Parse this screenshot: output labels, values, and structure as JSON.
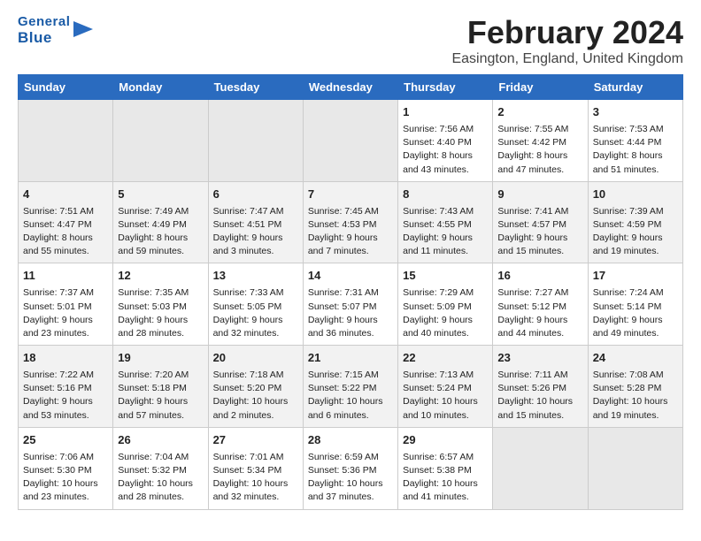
{
  "header": {
    "logo_general": "General",
    "logo_blue": "Blue",
    "title": "February 2024",
    "subtitle": "Easington, England, United Kingdom"
  },
  "weekdays": [
    "Sunday",
    "Monday",
    "Tuesday",
    "Wednesday",
    "Thursday",
    "Friday",
    "Saturday"
  ],
  "weeks": [
    [
      {
        "day": "",
        "info": ""
      },
      {
        "day": "",
        "info": ""
      },
      {
        "day": "",
        "info": ""
      },
      {
        "day": "",
        "info": ""
      },
      {
        "day": "1",
        "info": "Sunrise: 7:56 AM\nSunset: 4:40 PM\nDaylight: 8 hours\nand 43 minutes."
      },
      {
        "day": "2",
        "info": "Sunrise: 7:55 AM\nSunset: 4:42 PM\nDaylight: 8 hours\nand 47 minutes."
      },
      {
        "day": "3",
        "info": "Sunrise: 7:53 AM\nSunset: 4:44 PM\nDaylight: 8 hours\nand 51 minutes."
      }
    ],
    [
      {
        "day": "4",
        "info": "Sunrise: 7:51 AM\nSunset: 4:47 PM\nDaylight: 8 hours\nand 55 minutes."
      },
      {
        "day": "5",
        "info": "Sunrise: 7:49 AM\nSunset: 4:49 PM\nDaylight: 8 hours\nand 59 minutes."
      },
      {
        "day": "6",
        "info": "Sunrise: 7:47 AM\nSunset: 4:51 PM\nDaylight: 9 hours\nand 3 minutes."
      },
      {
        "day": "7",
        "info": "Sunrise: 7:45 AM\nSunset: 4:53 PM\nDaylight: 9 hours\nand 7 minutes."
      },
      {
        "day": "8",
        "info": "Sunrise: 7:43 AM\nSunset: 4:55 PM\nDaylight: 9 hours\nand 11 minutes."
      },
      {
        "day": "9",
        "info": "Sunrise: 7:41 AM\nSunset: 4:57 PM\nDaylight: 9 hours\nand 15 minutes."
      },
      {
        "day": "10",
        "info": "Sunrise: 7:39 AM\nSunset: 4:59 PM\nDaylight: 9 hours\nand 19 minutes."
      }
    ],
    [
      {
        "day": "11",
        "info": "Sunrise: 7:37 AM\nSunset: 5:01 PM\nDaylight: 9 hours\nand 23 minutes."
      },
      {
        "day": "12",
        "info": "Sunrise: 7:35 AM\nSunset: 5:03 PM\nDaylight: 9 hours\nand 28 minutes."
      },
      {
        "day": "13",
        "info": "Sunrise: 7:33 AM\nSunset: 5:05 PM\nDaylight: 9 hours\nand 32 minutes."
      },
      {
        "day": "14",
        "info": "Sunrise: 7:31 AM\nSunset: 5:07 PM\nDaylight: 9 hours\nand 36 minutes."
      },
      {
        "day": "15",
        "info": "Sunrise: 7:29 AM\nSunset: 5:09 PM\nDaylight: 9 hours\nand 40 minutes."
      },
      {
        "day": "16",
        "info": "Sunrise: 7:27 AM\nSunset: 5:12 PM\nDaylight: 9 hours\nand 44 minutes."
      },
      {
        "day": "17",
        "info": "Sunrise: 7:24 AM\nSunset: 5:14 PM\nDaylight: 9 hours\nand 49 minutes."
      }
    ],
    [
      {
        "day": "18",
        "info": "Sunrise: 7:22 AM\nSunset: 5:16 PM\nDaylight: 9 hours\nand 53 minutes."
      },
      {
        "day": "19",
        "info": "Sunrise: 7:20 AM\nSunset: 5:18 PM\nDaylight: 9 hours\nand 57 minutes."
      },
      {
        "day": "20",
        "info": "Sunrise: 7:18 AM\nSunset: 5:20 PM\nDaylight: 10 hours\nand 2 minutes."
      },
      {
        "day": "21",
        "info": "Sunrise: 7:15 AM\nSunset: 5:22 PM\nDaylight: 10 hours\nand 6 minutes."
      },
      {
        "day": "22",
        "info": "Sunrise: 7:13 AM\nSunset: 5:24 PM\nDaylight: 10 hours\nand 10 minutes."
      },
      {
        "day": "23",
        "info": "Sunrise: 7:11 AM\nSunset: 5:26 PM\nDaylight: 10 hours\nand 15 minutes."
      },
      {
        "day": "24",
        "info": "Sunrise: 7:08 AM\nSunset: 5:28 PM\nDaylight: 10 hours\nand 19 minutes."
      }
    ],
    [
      {
        "day": "25",
        "info": "Sunrise: 7:06 AM\nSunset: 5:30 PM\nDaylight: 10 hours\nand 23 minutes."
      },
      {
        "day": "26",
        "info": "Sunrise: 7:04 AM\nSunset: 5:32 PM\nDaylight: 10 hours\nand 28 minutes."
      },
      {
        "day": "27",
        "info": "Sunrise: 7:01 AM\nSunset: 5:34 PM\nDaylight: 10 hours\nand 32 minutes."
      },
      {
        "day": "28",
        "info": "Sunrise: 6:59 AM\nSunset: 5:36 PM\nDaylight: 10 hours\nand 37 minutes."
      },
      {
        "day": "29",
        "info": "Sunrise: 6:57 AM\nSunset: 5:38 PM\nDaylight: 10 hours\nand 41 minutes."
      },
      {
        "day": "",
        "info": ""
      },
      {
        "day": "",
        "info": ""
      }
    ]
  ]
}
